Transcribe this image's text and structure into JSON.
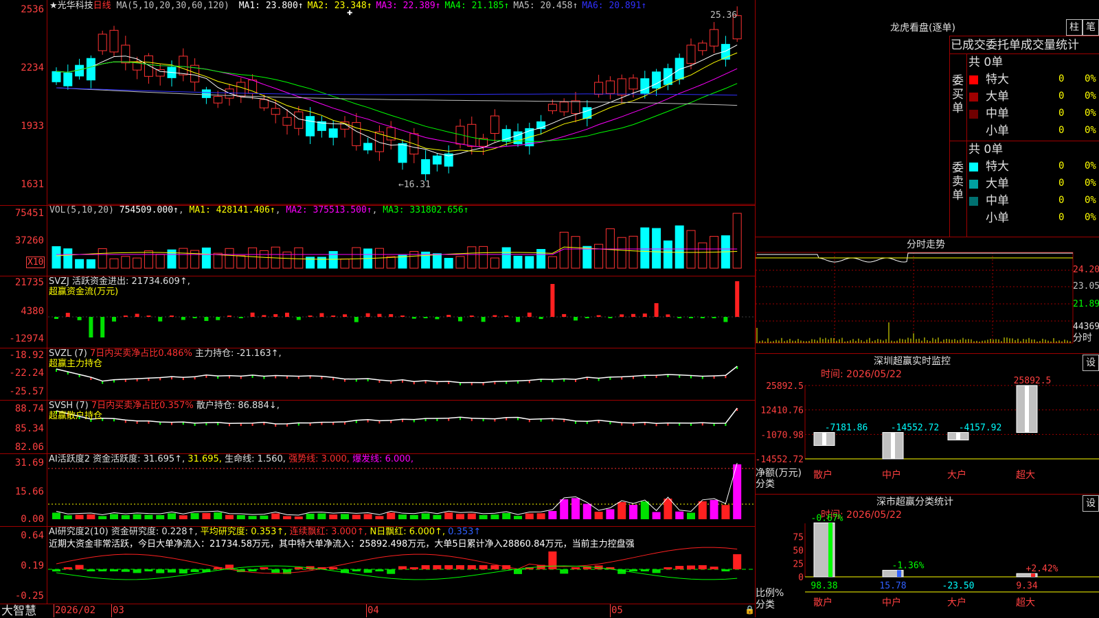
{
  "stock": {
    "name": "★光华科技",
    "period": "日线"
  },
  "main": {
    "ma_label": "MA(5,10,20,30,60,120)",
    "ma": [
      {
        "label": "MA1:",
        "value": "23.800↑",
        "color": "#ffffff"
      },
      {
        "label": "MA2:",
        "value": "23.348↑",
        "color": "#ffff00"
      },
      {
        "label": "MA3:",
        "value": "22.389↑",
        "color": "#ff00ff"
      },
      {
        "label": "MA4:",
        "value": "21.185↑",
        "color": "#00ff00"
      },
      {
        "label": "MA5:",
        "value": "20.458↑",
        "color": "#c0c0c0"
      },
      {
        "label": "MA6:",
        "value": "20.891↑",
        "color": "#3030ff"
      }
    ],
    "yticks": [
      "2536",
      "2234",
      "1933",
      "1631"
    ],
    "high_label": "25.36",
    "low_label": "←16.31"
  },
  "vol": {
    "label": "VOL(5,10,20)",
    "value": "754509.000↑",
    "ma1": "MA1: 428141.406↑",
    "ma2": "MA2: 375513.500↑",
    "ma3": "MA3: 331802.656↑",
    "yticks": [
      "75451",
      "37260"
    ],
    "unit": "X10"
  },
  "svzj": {
    "label": "SVZJ  活跃资金进出: 21734.609↑,",
    "sub": "超赢资金流(万元)",
    "yticks": [
      "21735",
      "4380",
      "-12974"
    ]
  },
  "svzl": {
    "label": "SVZL (7) ",
    "red": "7日内买卖净占比0.486%",
    "rest": " 主力持仓: -21.163↑,",
    "sub": "超赢主力持仓",
    "yticks": [
      "-18.92",
      "-22.24",
      "-25.57"
    ]
  },
  "svsh": {
    "label": "SVSH (7) ",
    "red": "7日内买卖净占比0.357%",
    "rest": " 散户持仓: 86.884↓,",
    "sub": "超赢散户持仓",
    "yticks": [
      "88.74",
      "85.34",
      "82.06"
    ]
  },
  "ai1": {
    "label": "AI活跃度2 资金活跃度: 31.695↑,",
    "v2": "31.695,",
    "v3": "生命线: 1.560,",
    "v4": "强势线: 3.000,",
    "v5": "爆发线: 6.000,",
    "yticks": [
      "31.69",
      "15.66",
      "0.00"
    ]
  },
  "ai2": {
    "label": "AI研究度2(10) 资金研究度: 0.228↑,",
    "v2": "平均研究度: 0.353↑,",
    "v3": "连续飘红: 3.000↑,",
    "v4": "N日飘红: 6.000↑,",
    "v5": "0.353↑",
    "desc": "近期大资金非常活跃，今日大单净流入：21734.58万元，其中特大单净流入：25892.498万元，大单5日累计净入28860.84万元，当前主力控盘强",
    "yticks": [
      "0.64",
      "0.19",
      "-0.25"
    ]
  },
  "bottom": {
    "brand": "大智慧",
    "dates": [
      "2026/02",
      "03",
      "04",
      "05"
    ]
  },
  "lhb": {
    "title": "龙虎看盘(逐单)",
    "btn1": "柱",
    "btn2": "笔",
    "header": "已成交委托单成交量统计",
    "buy": {
      "side": "委买单",
      "total": "共 0单",
      "rows": [
        {
          "name": "特大",
          "v": "0",
          "p": "0%",
          "color": "#ff0000"
        },
        {
          "name": "大单",
          "v": "0",
          "p": "0%",
          "color": "#a00000"
        },
        {
          "name": "中单",
          "v": "0",
          "p": "0%",
          "color": "#700000"
        },
        {
          "name": "小单",
          "v": "0",
          "p": "0%",
          "color": "#000000"
        }
      ]
    },
    "sell": {
      "side": "委卖单",
      "total": "共 0单",
      "rows": [
        {
          "name": "特大",
          "v": "0",
          "p": "0%",
          "color": "#00ffff"
        },
        {
          "name": "大单",
          "v": "0",
          "p": "0%",
          "color": "#00a0a0"
        },
        {
          "name": "中单",
          "v": "0",
          "p": "0%",
          "color": "#007070"
        },
        {
          "name": "小单",
          "v": "0",
          "p": "0%",
          "color": "#000000"
        }
      ]
    }
  },
  "intraday": {
    "title": "分时走势",
    "yticks": [
      "24.20",
      "23.05",
      "21.89"
    ],
    "vol": "44369",
    "unit": "分时"
  },
  "sz_monitor": {
    "title": "深圳超赢实时监控",
    "btn": "设",
    "time": "时间: 2026/05/22",
    "yticks": [
      "25892.5",
      "12410.76",
      "-1070.98",
      "-14552.72"
    ],
    "ylabel": "净额(万元)",
    "xlabel": "分类",
    "chart_data": {
      "type": "bar",
      "categories": [
        "散户",
        "中户",
        "大户",
        "超大"
      ],
      "values": [
        -7181.86,
        -14552.72,
        -4157.92,
        25892.5
      ],
      "value_labels": [
        "-7181.86",
        "-14552.72",
        "-4157.92",
        "25892.5"
      ],
      "ylim": [
        -14552.72,
        25892.5
      ],
      "ylabel": "净额(万元)",
      "xlabel": "分类"
    }
  },
  "sz_class": {
    "title": "深市超赢分类统计",
    "btn": "设",
    "time": "时间: 2026/05/22",
    "yticks": [
      "75",
      "50",
      "25",
      "0"
    ],
    "ylabel": "比例%",
    "xlabel": "分类",
    "chart_data": {
      "type": "bar",
      "categories": [
        "散户",
        "中户",
        "大户",
        "超大"
      ],
      "top_labels": [
        "-0.67%",
        "-1.36%",
        "",
        "+2.42%"
      ],
      "bottom_labels": [
        "98.38",
        "15.78",
        "-23.50",
        "9.34"
      ],
      "ylim": [
        0,
        100
      ]
    }
  }
}
